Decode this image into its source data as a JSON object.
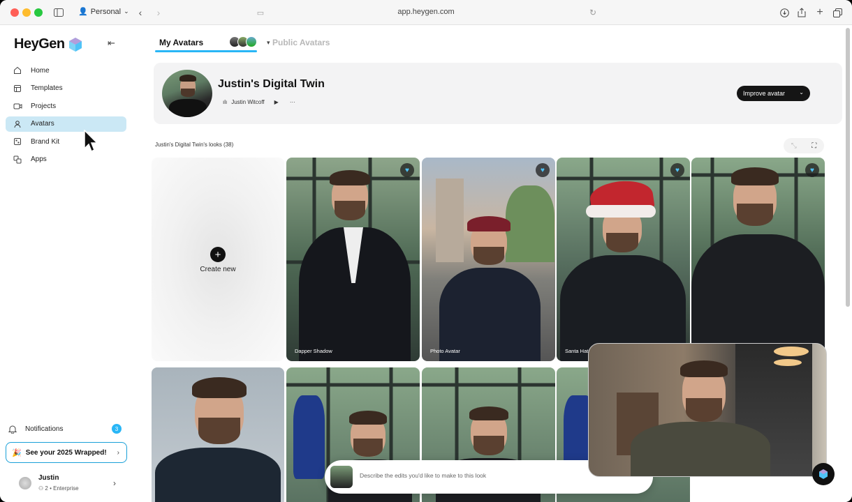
{
  "browser": {
    "profile": "Personal",
    "url": "app.heygen.com"
  },
  "sidebar": {
    "logo": "HeyGen",
    "items": [
      {
        "label": "Home",
        "icon": "home-icon"
      },
      {
        "label": "Templates",
        "icon": "templates-icon"
      },
      {
        "label": "Projects",
        "icon": "projects-icon"
      },
      {
        "label": "Avatars",
        "icon": "avatar-icon",
        "active": true
      },
      {
        "label": "Brand Kit",
        "icon": "brand-kit-icon"
      },
      {
        "label": "Apps",
        "icon": "apps-icon"
      }
    ],
    "notifications_label": "Notifications",
    "notifications_count": "3",
    "wrapped_label": "See your 2025 Wrapped!",
    "user_name": "Justin",
    "user_seats": "2",
    "user_plan": "• Enterprise"
  },
  "main": {
    "tabs": [
      {
        "label": "My Avatars",
        "active": true
      },
      {
        "label": "Public Avatars",
        "active": false
      }
    ],
    "hero": {
      "title": "Justin's Digital Twin",
      "voice_name": "Justin Witcoff",
      "improve_label": "Improve avatar"
    },
    "looks_label": "Justin's Digital Twin's looks (38)",
    "create_label": "Create new",
    "cards": [
      {
        "caption": "Dapper Shadow"
      },
      {
        "caption": "Photo Avatar"
      },
      {
        "caption": "Santa Hat Jo"
      },
      {
        "caption": ""
      }
    ],
    "prompt_placeholder": "Describe the edits you'd like to make to this look"
  },
  "colors": {
    "accent": "#29b6f6",
    "active_nav": "#cbe8f5",
    "dark_button": "#151515"
  }
}
